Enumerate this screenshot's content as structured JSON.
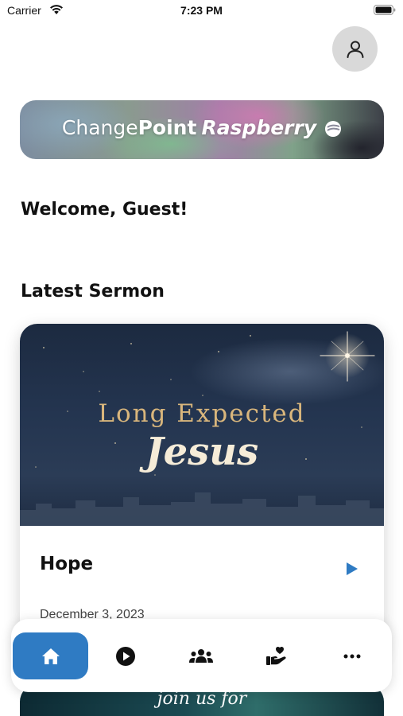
{
  "status_bar": {
    "carrier": "Carrier",
    "time": "7:23 PM"
  },
  "banner": {
    "part1": "Change",
    "part2": "Point",
    "part3": "Raspberry"
  },
  "welcome": "Welcome, Guest!",
  "latest_sermon": {
    "heading": "Latest Sermon",
    "art_line1": "Long Expected",
    "art_line2": "Jesus",
    "title": "Hope",
    "date": "December 3, 2023"
  },
  "next_card": {
    "text": "join us for"
  },
  "nav": {
    "active": "home",
    "items": [
      {
        "id": "home",
        "icon": "home-icon"
      },
      {
        "id": "watch",
        "icon": "play-circle-icon"
      },
      {
        "id": "connect",
        "icon": "people-icon"
      },
      {
        "id": "give",
        "icon": "hand-heart-icon"
      },
      {
        "id": "more",
        "icon": "ellipsis-icon"
      }
    ]
  },
  "colors": {
    "accent": "#2f7bc3",
    "profile_bg": "#d9d9d9"
  }
}
